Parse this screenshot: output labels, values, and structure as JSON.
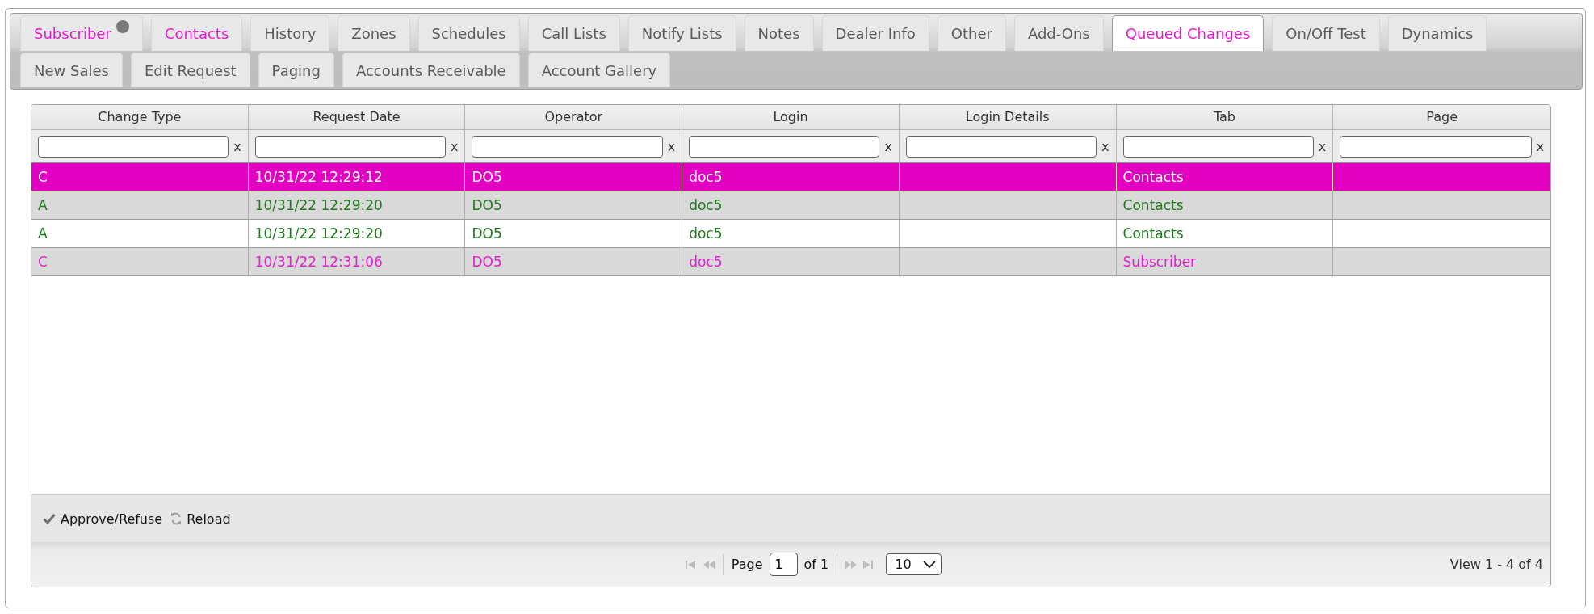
{
  "tab_rows": [
    {
      "tabs": [
        {
          "label": "Subscriber",
          "selected": false,
          "modified": true,
          "marker": true
        },
        {
          "label": "Contacts",
          "selected": false,
          "modified": true,
          "marker": false
        },
        {
          "label": "History",
          "selected": false,
          "modified": false,
          "marker": false
        },
        {
          "label": "Zones",
          "selected": false,
          "modified": false,
          "marker": false
        },
        {
          "label": "Schedules",
          "selected": false,
          "modified": false,
          "marker": false
        },
        {
          "label": "Call Lists",
          "selected": false,
          "modified": false,
          "marker": false
        },
        {
          "label": "Notify Lists",
          "selected": false,
          "modified": false,
          "marker": false
        },
        {
          "label": "Notes",
          "selected": false,
          "modified": false,
          "marker": false
        },
        {
          "label": "Dealer Info",
          "selected": false,
          "modified": false,
          "marker": false
        },
        {
          "label": "Other",
          "selected": false,
          "modified": false,
          "marker": false
        },
        {
          "label": "Add-Ons",
          "selected": false,
          "modified": false,
          "marker": false
        },
        {
          "label": "Queued Changes",
          "selected": true,
          "modified": false,
          "marker": false
        },
        {
          "label": "On/Off Test",
          "selected": false,
          "modified": false,
          "marker": false
        },
        {
          "label": "Dynamics",
          "selected": false,
          "modified": false,
          "marker": false
        }
      ]
    },
    {
      "tabs": [
        {
          "label": "New Sales",
          "selected": false,
          "modified": false,
          "marker": false
        },
        {
          "label": "Edit Request",
          "selected": false,
          "modified": false,
          "marker": false
        },
        {
          "label": "Paging",
          "selected": false,
          "modified": false,
          "marker": false
        },
        {
          "label": "Accounts Receivable",
          "selected": false,
          "modified": false,
          "marker": false
        },
        {
          "label": "Account Gallery",
          "selected": false,
          "modified": false,
          "marker": false
        }
      ]
    }
  ],
  "grid": {
    "columns": [
      {
        "title": "Change Type",
        "clear": "x"
      },
      {
        "title": "Request Date",
        "clear": "x"
      },
      {
        "title": "Operator",
        "clear": "x"
      },
      {
        "title": "Login",
        "clear": "x"
      },
      {
        "title": "Login Details",
        "clear": "x"
      },
      {
        "title": "Tab",
        "clear": "x"
      },
      {
        "title": "Page",
        "clear": "x"
      }
    ],
    "rows": [
      {
        "selected": true,
        "change_type": "C",
        "request_date": "10/31/22 12:29:12",
        "operator": "DO5",
        "login": "doc5",
        "tab": "Contacts"
      },
      {
        "selected": false,
        "color": "#1f7a1f",
        "change_type": "A",
        "request_date": "10/31/22 12:29:20",
        "operator": "DO5",
        "login": "doc5",
        "tab": "Contacts"
      },
      {
        "selected": false,
        "color": "#1f7a1f",
        "change_type": "A",
        "request_date": "10/31/22 12:29:20",
        "operator": "DO5",
        "login": "doc5",
        "tab": "Contacts"
      },
      {
        "selected": false,
        "color": "#e41fcf",
        "change_type": "C",
        "request_date": "10/31/22 12:31:06",
        "operator": "DO5",
        "login": "doc5",
        "tab": "Subscriber"
      }
    ]
  },
  "toolbar": {
    "actions": [
      {
        "kind": "approve",
        "label": "Approve/Refuse"
      },
      {
        "kind": "reload",
        "label": "Reload"
      }
    ]
  },
  "pager": {
    "nav": [
      {
        "kind": "first",
        "disabled": true
      },
      {
        "kind": "prev",
        "disabled": true
      },
      {
        "kind": "next",
        "disabled": true
      },
      {
        "kind": "last",
        "disabled": true
      }
    ],
    "page_label": "Page",
    "page": "1",
    "page_count": "of 1",
    "page_size": "10",
    "summary": "View 1 - 4 of 4"
  }
}
